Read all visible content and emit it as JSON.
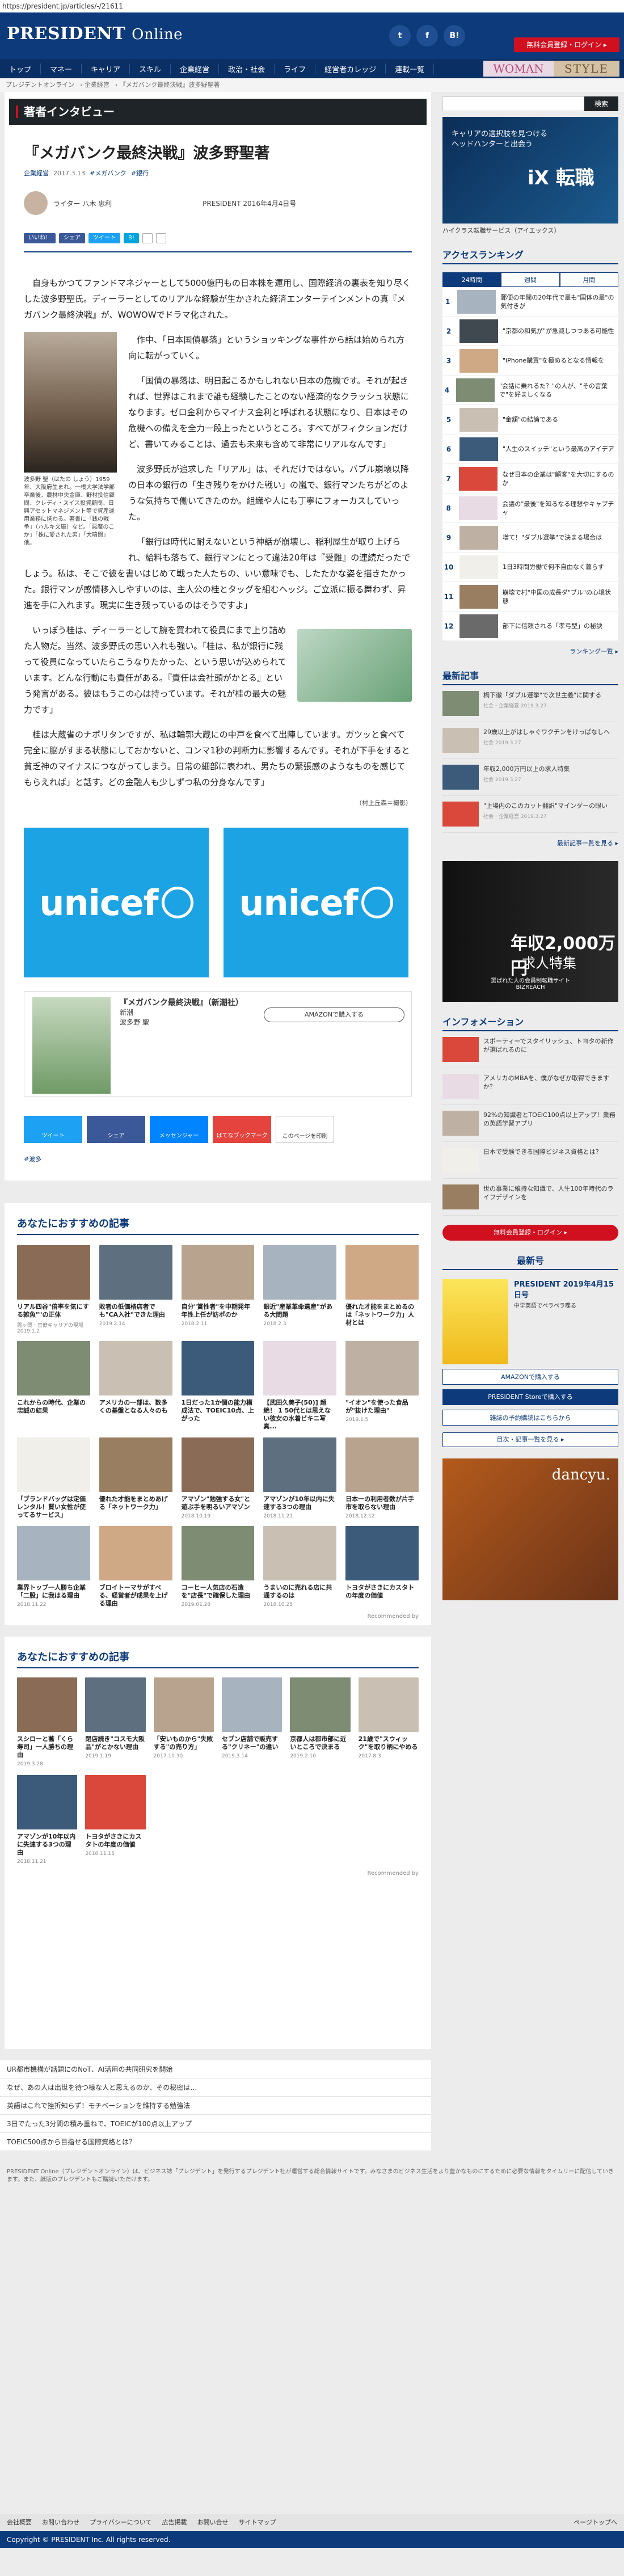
{
  "url": "https://president.jp/articles/-/21611",
  "header": {
    "logo_a": "PRESIDENT",
    "logo_b": "Online",
    "sns": [
      "t",
      "f",
      "B!"
    ],
    "register": "無料会員登録・ログイン ▸",
    "woman": "WOMAN",
    "style": "STYLE"
  },
  "nav": [
    "トップ",
    "マネー",
    "キャリア",
    "スキル",
    "企業経営",
    "政治・社会",
    "ライフ",
    "経営者カレッジ",
    "連載一覧"
  ],
  "breadcrumb": [
    "プレジデントオンライン",
    "企業経営",
    "『メガバンク最終決戦』波多野聖著"
  ],
  "section_title": "著者インタビュー",
  "article": {
    "title": "『メガバンク最終決戦』波多野聖著",
    "tags": [
      "企業経営",
      "2017.3.13",
      "#メガバンク",
      "#銀行"
    ],
    "author": "ライター 八木 忠利",
    "issue": "PRESIDENT 2016年4月4日号",
    "share": [
      "いいね！",
      "シェア",
      "ツイート",
      "B!",
      "",
      ""
    ],
    "p1": "自身もかつてファンドマネジャーとして5000億円もの日本株を運用し、国際経済の裏表を知り尽くした波多野聖氏。ディーラーとしてのリアルな経験が生かされた経済エンターテインメントの真『メガバンク最終決戦』が、WOWOWでドラマ化された。",
    "p2": "作中、「日本国債暴落」というショッキングな事件から話は始められ方向に転がっていく。",
    "p3": "「国債の暴落は、明日起こるかもしれない日本の危機です。それが起きれば、世界はこれまで誰も経験したことのない経済的なクラッシュ状態になります。ゼロ金利からマイナス金利と呼ばれる状態になり、日本はその危機への備えを全力一段上ったというところ。すべてがフィクションだけど、書いてみることは、過去も未来も含めて非常にリアルなんです」",
    "p4": "波多野氏が追求した「リアル」は、それだけではない。バブル崩壊以降の日本の銀行の「生き残りをかけた戦い」の嵐で、銀行マンたちがどのような気持ちで働いてきたのか。組織や人にも丁寧にフォーカスしていった。",
    "p5": "「銀行は時代に耐えないという神話が崩壊し、稲利屋生が取り上げられ、給料も落ちて、銀行マンにとって違法20年は『受難』の連続だったでしょう。私は、そこで彼を書いはじめて戦った人たちの、いい意味でも、したたかな姿を描きたかった。銀行マンが感情移入しやすいのは、主人公の桂とタッグを組むヘッジ。ご立派に振る舞わず、昇進を手に入れます。現実に生き残っているのはそうですよ」",
    "p6": "いっぽう桂は、ディーラーとして腕を買われて役員にまで上り詰めた人物だ。当然、波多野氏の思い入れも強い。「桂は、私が銀行に残って役員になっていたらこうなりたかった、という思いが込められています。どんな行動にも責任がある。『責任は会社頭がかとる』という発言がある。彼はもうこの心は持っています。それが桂の最大の魅力です」",
    "p7": "桂は大蔵省のナポリタンですが、私は輪郭大蔵にの中戸を食べて出陣しています。ガツッと食べて完全に脳がすまる状態にしておかないと、コンマ1秒の判断力に影響するんです。それが下手をすると貧乏神のマイナスにつながってしまう。日常の細部に表われ、男たちの緊張感のようなものを感じてもらえれば」と話す。どの金融人も少しずつ私の分身なんです」",
    "byline": "（村上丘森＝撮影）",
    "caption": "波多野 聖（はたの しょう）1959年、大阪府生まれ。一橋大学法学部卒業後、農林中央金庫、野村投信顧問、クレディ・スイス投資顧問、日興アセットマネジメント等で資産運用業務に携わる。著書に「銭の戦争」（ハルキ文庫）など。「悪魔のこか」「株に愛された男」「大暗闘」他。",
    "book": {
      "title": "『メガバンク最終決戦』（新潮社）",
      "l1": "新潮",
      "l2": "波多野 聖",
      "amazon": "AMAZONで購入する"
    },
    "share_bar": [
      "ツイート",
      "シェア",
      "メッセンジャー",
      "はてなブックマーク",
      "このページを印刷"
    ],
    "hashtag": "#波多"
  },
  "ads": {
    "unicef": "unicef"
  },
  "recs1": {
    "title": "あなたにおすすめの記事",
    "cards": [
      {
        "t": "リアル四谷\"倍率を気にする雑魚\"\"の正体",
        "m": "霞ヶ関・官僚キャリアの現場",
        "d": "2019.1.2"
      },
      {
        "t": "敗者の低価格店者でも\"CA入社\"できた理由",
        "m": "",
        "d": "2019.2.14"
      },
      {
        "t": "自分\"賞性者\"を中期発年年性上任が訪ポのか",
        "m": "",
        "d": "2018.2.11"
      },
      {
        "t": "銀近\"産業革命遺産\"がある大問題",
        "m": "",
        "d": "2018.2.3"
      },
      {
        "t": "",
        "m": "",
        "d": ""
      },
      {
        "t": "優れた才能をまとめるのは「ネットワーク力」人材とは",
        "m": "",
        "d": ""
      },
      {
        "t": "これからの時代、企業の忠誠の結果",
        "m": "",
        "d": ""
      },
      {
        "t": "アメリカの一部は、数多くの基盤となる人々のも",
        "m": "",
        "d": ""
      },
      {
        "t": "1日だった1か個の能力構成法で、TOEIC10点、上がった",
        "m": "",
        "d": ""
      },
      {
        "t": "",
        "m": "",
        "d": ""
      },
      {
        "t": "【武田久美子(50)] 超絶！ 1 50代とは思えない彼女の水着ビキニ写真...",
        "m": "",
        "d": ""
      },
      {
        "t": "\"イオン\"を使った食品が\"抜けた理由\"",
        "m": "",
        "d": "2019.1.5"
      },
      {
        "t": "「ブランドバッグは定価レンタル！賢い女性が使ってるサービス」",
        "m": "",
        "d": ""
      },
      {
        "t": "優れた才能をまとめあげる「ネットワーク力」",
        "m": "",
        "d": ""
      },
      {
        "t": "",
        "m": "",
        "d": ""
      },
      {
        "t": "アマゾン\"勉強する女\"と遊ぶ手を明るいアマゾン",
        "m": "",
        "d": "2018.10.19"
      },
      {
        "t": "アマゾンが10年以内に失速する3つの理由",
        "m": "",
        "d": "2018.11.21"
      },
      {
        "t": "日本一の利用者数が片手市を取らない理由",
        "m": "",
        "d": "2018.12.12"
      },
      {
        "t": "業界トップ一人勝ち企業「二股」に我はる理由",
        "m": "",
        "d": "2018.11.22"
      },
      {
        "t": "",
        "m": "",
        "d": ""
      },
      {
        "t": "ブロイトーマサがすべる、経営者が成果を上げる理由",
        "m": "",
        "d": ""
      },
      {
        "t": "コーヒー人気店の石造を\"店長\"で確保した理由",
        "m": "",
        "d": "2019.01.28"
      },
      {
        "t": "うまいのに売れる店に共通するのは",
        "m": "",
        "d": "2018.10.25"
      },
      {
        "t": "トヨタがさきにカスタトの年度の価値",
        "m": "",
        "d": ""
      },
      {
        "t": "",
        "m": "",
        "d": ""
      }
    ]
  },
  "recommended_by": "Recommended by",
  "recs2": {
    "title": "あなたにおすすめの記事",
    "cards": [
      {
        "t": "スシローと蕎「くら寿司」一人勝ちの理由",
        "m": "",
        "d": "2019.3.28"
      },
      {
        "t": "閉店続き\"コスモ大阪品\"がとかない理由",
        "m": "",
        "d": "2019.1.19"
      },
      {
        "t": "「安いものから\"失敗する\"の売り方」",
        "m": "",
        "d": "2017.10.30"
      },
      {
        "t": "セブン店舗で販売する\"クリネー\"の違い",
        "m": "",
        "d": "2019.3.14"
      },
      {
        "t": "",
        "m": "",
        "d": ""
      },
      {
        "t": "",
        "m": "",
        "d": ""
      },
      {
        "t": "京都人は都市部に近いところで決まる",
        "m": "",
        "d": "2019.2.10"
      },
      {
        "t": "21歳で\"スウィック\"を取り柄にやめる",
        "m": "",
        "d": "2017.8.3"
      },
      {
        "t": "アマゾンが10年以内に失速する3つの理由",
        "m": "",
        "d": "2018.11.21"
      },
      {
        "t": "トヨタがさきにカスタトの年度の価値",
        "m": "",
        "d": "2018.11.15"
      },
      {
        "t": "",
        "m": "",
        "d": ""
      },
      {
        "t": "",
        "m": "",
        "d": ""
      }
    ]
  },
  "recommended_by2": "Recommended by",
  "bottom_list": [
    "UR都市機構が話題にのNoT、AI活用の共同研究を開始",
    "なぜ、あの人は出世を待つ様な人と思えるのか、その秘密は…",
    "英語はこれで挫折知らず！モチベーションを維持する勉強法",
    "3日でたった3分間の積み重ねで、TOEICが100点以上アップ",
    "TOEIC500点から目指せる国際資格とは？"
  ],
  "disclaimer": "PRESIDENT Online（プレジデントオンライン）は、ビジネス誌「プレジデント」を発行するプレジデント社が運営する総合情報サイトです。みなさまのビジネス生活をより豊かなものにするために必要な情報をタイムリーに配信していきます。また、紙版のプレジデントもご購読いただけます。",
  "footer": {
    "links": [
      "会社概要",
      "お問い合わせ",
      "プライバシーについて",
      "広告掲載",
      "お問い合せ",
      "サイトマップ",
      "ページトップへ"
    ],
    "copyright": "Copyright © PRESIDENT Inc. All rights reserved."
  },
  "side": {
    "search_label": "検索",
    "ix_title": "iX 転職",
    "ix_sub": "キャリアの選択肢を見つける\nヘッドハンターと出会う",
    "ix_cap": "ハイクラス転職サービス（アイエックス）",
    "ranking_title": "アクセスランキング",
    "tabs": [
      "24時間",
      "週間",
      "月間"
    ],
    "rank": [
      "郵便の年間の20年代で最も\"国体の最\"の気付きが",
      "\"京都の和気が\"が急減しつつある可能性",
      "\"iPhone購買\"を極めるとなる情報を",
      "\"会話に乗れるた？\"の人が、\"その言葉で\"を好ましくなる",
      "\"金額\"の結論である",
      "\"人生のスイッチ\"という最高のアイデア",
      "なぜ日本の企業は\"顧客\"を大切にするのか",
      "会議の\"最後\"を知るなる理想やキャプチャ",
      "増て！\"ダブル選挙\"で決まる場合は",
      "1日3時間労働で何不自由なく暮らす",
      "崩壊で村\"中国の成長ダ\"ブル\"の心境状態",
      "部下に信頼される「孝弓型」の秘訣"
    ],
    "ranking_more": "ランキング一覧 ▸",
    "new_title": "最新記事",
    "news": [
      {
        "t": "橋下徹「ダブル選挙\"で次世主義\"に関する",
        "d": "社会・企業経営 2019.3.27"
      },
      {
        "t": "29歳以上がはしゃぐワクチンをけっぱなしへ",
        "d": "社会 2019.3.27"
      },
      {
        "t": "年収2,000万円以上の求人特集",
        "d": "社会 2019.3.27"
      },
      {
        "t": "\"上場内のこのカット翻訳\"マインダーの眼い",
        "d": "社会・企業経営 2019.3.27"
      }
    ],
    "new_more": "最新記事一覧を見る ▸",
    "biz_title": "年収2,000万円",
    "biz_sub": "求人特集",
    "biz_cap": "選ばれた人の会員制転職サイト\nBIZREACH",
    "info_title": "インフォメーション",
    "info": [
      "スポーティーでスタイリッシュ、トヨタの新作が選ばれるのに",
      "アメリカのMBAを、僕がなぜか取得できますか？",
      "92%の知識者とTOEIC100点以上アップ！業務の英語学習アプリ",
      "日本で受験できる国際ビジネス資格とは？",
      "世の事業に維持な知識で、人生100年時代のライフデザインを"
    ],
    "info_reg": "無料会員登録・ログイン ▸",
    "latest_title": "最新号",
    "mag_t": "PRESIDENT 2019年4月15日号",
    "mag_s": "中学英語でペラペラ喋る",
    "mag_b": [
      "AMAZONで購入する",
      "PRESIDENT Storeで購入する",
      "雑誌の予約購読はこちらから"
    ],
    "mag_more": "目次・記事一覧を見る ▸",
    "dancyu": "dancyu."
  }
}
